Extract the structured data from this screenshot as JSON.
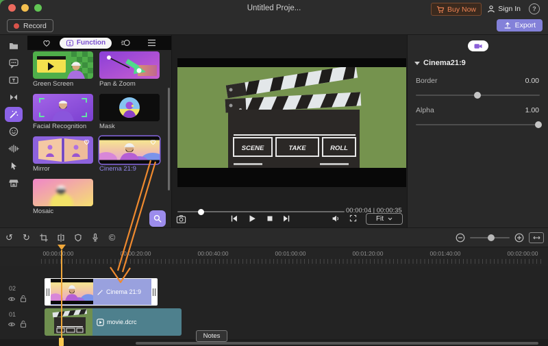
{
  "window": {
    "title": "Untitled Proje..."
  },
  "topbar": {
    "buy_now": "Buy Now",
    "sign_in": "Sign In",
    "help": "?",
    "record": "Record",
    "export": "Export"
  },
  "sidebar": {
    "active_item": "effects",
    "items": [
      "media",
      "audio-comments",
      "titles",
      "transitions",
      "effects",
      "stickers",
      "audio-mixer",
      "cursor",
      "store"
    ]
  },
  "effects_panel": {
    "tabs": {
      "function": "Function"
    },
    "items": [
      {
        "label": "Green Screen"
      },
      {
        "label": "Pan & Zoom"
      },
      {
        "label": "Facial Recognition"
      },
      {
        "label": "Mask"
      },
      {
        "label": "Mirror",
        "favorite": true
      },
      {
        "label": "Cinema 21:9",
        "favorite": true,
        "selected": true
      },
      {
        "label": "Mosaic"
      }
    ]
  },
  "preview": {
    "current_time": "00:00:04",
    "separator": "|",
    "duration": "00:00:35",
    "fit": "Fit",
    "progress_pct": 13,
    "clapper": {
      "scene": "SCENE",
      "take": "TAKE",
      "roll": "ROLL"
    }
  },
  "properties": {
    "title": "Cinema21:9",
    "rows": [
      {
        "label": "Border",
        "value": "0.00",
        "pct": 47
      },
      {
        "label": "Alpha",
        "value": "1.00",
        "pct": 96
      }
    ]
  },
  "timeline": {
    "ruler": [
      "00:00:00:00",
      "00:00:20:00",
      "00:00:40:00",
      "00:01:00:00",
      "00:01:20:00",
      "00:01:40:00",
      "00:02:00:00"
    ],
    "tracks": [
      {
        "number": "02",
        "clip": "Cinema 21:9"
      },
      {
        "number": "01",
        "clip": "movie.dcrc"
      }
    ],
    "notes": "Notes"
  },
  "icons": {
    "undo": "↺",
    "redo": "↻",
    "copyright": "©"
  },
  "colors": {
    "accent": "#8b62e6",
    "export_button": "#8381d9",
    "buy_now_text": "#ef8354",
    "playhead": "#f0a73a",
    "annotation_arrow": "#ef8a2f",
    "clip_cinema": "#99a1de",
    "clip_movie": "#4e808d",
    "selection": "#8566e0"
  }
}
